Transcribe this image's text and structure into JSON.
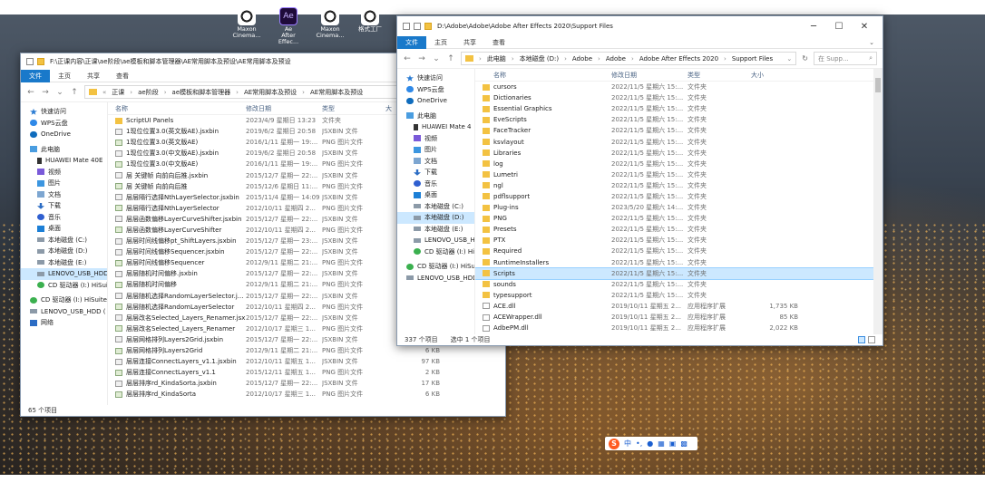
{
  "desktop": {
    "icons": [
      {
        "label": "Maxon\nCinema...",
        "icon": "maxon-icon"
      },
      {
        "label": "Ae\nAfter Effec...",
        "icon": "ae-icon",
        "glyph": "Ae"
      },
      {
        "label": "Maxon\nCinema...",
        "icon": "maxon-icon"
      },
      {
        "label": "格式工厂",
        "icon": "maxon-icon"
      }
    ]
  },
  "left_window": {
    "title": "F:\\正课内容\\正课\\ae阶段\\ae模板和脚本管理器\\AE常用脚本及预设\\AE常用脚本及预设",
    "ribbon": [
      "文件",
      "主页",
      "共享",
      "查看"
    ],
    "breadcrumb": [
      "正课",
      "ae阶段",
      "ae模板和脚本管理器",
      "AE常用脚本及预设",
      "AE常用脚本及预设"
    ],
    "headers": {
      "name": "名称",
      "date": "修改日期",
      "type": "类型",
      "size": "大"
    },
    "nav": [
      {
        "label": "快速访问",
        "icon": "star"
      },
      {
        "label": "WPS云盘",
        "icon": "cloud"
      },
      {
        "label": "OneDrive",
        "icon": "od"
      },
      {
        "label": "此电脑",
        "icon": "pc"
      },
      {
        "label": "HUAWEI Mate 40E",
        "icon": "phone",
        "indent": 1
      },
      {
        "label": "视频",
        "icon": "vid",
        "indent": 1
      },
      {
        "label": "图片",
        "icon": "pic",
        "indent": 1
      },
      {
        "label": "文档",
        "icon": "doc",
        "indent": 1
      },
      {
        "label": "下载",
        "icon": "down",
        "indent": 1
      },
      {
        "label": "音乐",
        "icon": "music",
        "indent": 1
      },
      {
        "label": "桌面",
        "icon": "desk",
        "indent": 1
      },
      {
        "label": "本地磁盘 (C:)",
        "icon": "drive",
        "indent": 1
      },
      {
        "label": "本地磁盘 (D:)",
        "icon": "drive",
        "indent": 1
      },
      {
        "label": "本地磁盘 (E:)",
        "icon": "drive",
        "indent": 1
      },
      {
        "label": "LENOVO_USB_HDD",
        "icon": "drive",
        "indent": 1,
        "selected": true
      },
      {
        "label": "CD 驱动器 (I:) HiSuite",
        "icon": "cd",
        "indent": 1
      },
      {
        "label": "CD 驱动器 (I:) HiSuite",
        "icon": "cd"
      },
      {
        "label": "LENOVO_USB_HDD (",
        "icon": "drive"
      },
      {
        "label": "网络",
        "icon": "net"
      }
    ],
    "files": [
      {
        "name": "ScriptUI Panels",
        "date": "2023/4/9 星期日 13:23",
        "type": "文件夹",
        "size": "",
        "icon": "folder"
      },
      {
        "name": "1现位位置3.0(英文版AE).jsxbin",
        "date": "2019/6/2 星期日 20:58",
        "type": "JSXBIN 文件",
        "size": "",
        "icon": "jsx"
      },
      {
        "name": "1现位位置3.0(英文版AE)",
        "date": "2016/1/11 星期一 19:...",
        "type": "PNG 图片文件",
        "size": "",
        "icon": "png"
      },
      {
        "name": "1现位位置3.0(中文版AE).jsxbin",
        "date": "2019/6/2 星期日 20:58",
        "type": "JSXBIN 文件",
        "size": "",
        "icon": "jsx"
      },
      {
        "name": "1现位位置3.0(中文版AE)",
        "date": "2016/1/11 星期一 19:...",
        "type": "PNG 图片文件",
        "size": "",
        "icon": "png"
      },
      {
        "name": "层 关键帧 向前向后推.jsxbin",
        "date": "2015/12/7 星期一 22:...",
        "type": "JSXBIN 文件",
        "size": "",
        "icon": "jsx"
      },
      {
        "name": "层 关键帧 向前向后推",
        "date": "2015/12/6 星期日 11:...",
        "type": "PNG 图片文件",
        "size": "",
        "icon": "png"
      },
      {
        "name": "层层隔行选择NthLayerSelector.jsxbin",
        "date": "2015/11/4 星期一 14:09",
        "type": "JSXBIN 文件",
        "size": "",
        "icon": "jsx"
      },
      {
        "name": "层层隔行选择NthLayerSelector",
        "date": "2012/10/11 星期四 2...",
        "type": "PNG 图片文件",
        "size": "",
        "icon": "png"
      },
      {
        "name": "层层函数偏移LayerCurveShifter.jsxbin",
        "date": "2015/12/7 星期一 22:...",
        "type": "JSXBIN 文件",
        "size": "",
        "icon": "jsx"
      },
      {
        "name": "层层函数偏移LayerCurveShifter",
        "date": "2012/10/11 星期四 2...",
        "type": "PNG 图片文件",
        "size": "",
        "icon": "png"
      },
      {
        "name": "层层时间线偏移pt_ShiftLayers.jsxbin",
        "date": "2015/12/7 星期一 23:...",
        "type": "JSXBIN 文件",
        "size": "",
        "icon": "jsx"
      },
      {
        "name": "层层时间线偏移Sequencer.jsxbin",
        "date": "2015/12/7 星期一 22:...",
        "type": "JSXBIN 文件",
        "size": "",
        "icon": "jsx"
      },
      {
        "name": "层层时间线偏移Sequencer",
        "date": "2012/9/11 星期二 21:...",
        "type": "PNG 图片文件",
        "size": "",
        "icon": "png"
      },
      {
        "name": "层层随机时间偏移.jsxbin",
        "date": "2015/12/7 星期一 22:...",
        "type": "JSXBIN 文件",
        "size": "",
        "icon": "jsx"
      },
      {
        "name": "层层随机时间偏移",
        "date": "2012/9/11 星期二 21:...",
        "type": "PNG 图片文件",
        "size": "",
        "icon": "png"
      },
      {
        "name": "层层随机选择RandomLayerSelector.j...",
        "date": "2015/12/7 星期一 22:...",
        "type": "JSXBIN 文件",
        "size": "",
        "icon": "jsx"
      },
      {
        "name": "层层随机选择RandomLayerSelector",
        "date": "2012/10/11 星期四 2...",
        "type": "PNG 图片文件",
        "size": "",
        "icon": "png"
      },
      {
        "name": "层层改名Selected_Layers_Renamer.jsxbin",
        "date": "2015/12/7 星期一 22:...",
        "type": "JSXBIN 文件",
        "size": "",
        "icon": "jsx"
      },
      {
        "name": "层层改名Selected_Layers_Renamer",
        "date": "2012/10/17 星期三 1...",
        "type": "PNG 图片文件",
        "size": "2 KB",
        "icon": "png"
      },
      {
        "name": "层层网格排列Layers2Grid.jsxbin",
        "date": "2015/12/7 星期一 22:...",
        "type": "JSXBIN 文件",
        "size": "3 KB",
        "icon": "jsx"
      },
      {
        "name": "层层网格排列Layers2Grid",
        "date": "2012/9/11 星期二 21:...",
        "type": "PNG 图片文件",
        "size": "6 KB",
        "icon": "png"
      },
      {
        "name": "层层连接ConnectLayers_v1.1.jsxbin",
        "date": "2012/10/11 星期五 1...",
        "type": "JSXBIN 文件",
        "size": "97 KB",
        "icon": "jsx"
      },
      {
        "name": "层层连接ConnectLayers_v1.1",
        "date": "2015/12/11 星期五 1...",
        "type": "PNG 图片文件",
        "size": "2 KB",
        "icon": "png"
      },
      {
        "name": "层层排序rd_KindaSorta.jsxbin",
        "date": "2015/12/7 星期一 22:...",
        "type": "JSXBIN 文件",
        "size": "17 KB",
        "icon": "jsx"
      },
      {
        "name": "层层排序rd_KindaSorta",
        "date": "2012/10/17 星期三 1...",
        "type": "PNG 图片文件",
        "size": "6 KB",
        "icon": "png"
      }
    ],
    "status": {
      "count": "65 个项目"
    }
  },
  "right_window": {
    "title": "D:\\Adobe\\Adobe\\Adobe After Effects 2020\\Support Files",
    "ribbon": [
      "文件",
      "主页",
      "共享",
      "查看"
    ],
    "breadcrumb": [
      "此电脑",
      "本地磁盘 (D:)",
      "Adobe",
      "Adobe",
      "Adobe After Effects 2020",
      "Support Files"
    ],
    "search_placeholder": "在 Supp...",
    "headers": {
      "name": "名称",
      "date": "修改日期",
      "type": "类型",
      "size": "大小"
    },
    "nav": [
      {
        "label": "快速访问",
        "icon": "star"
      },
      {
        "label": "WPS云盘",
        "icon": "cloud"
      },
      {
        "label": "OneDrive",
        "icon": "od"
      },
      {
        "label": "此电脑",
        "icon": "pc"
      },
      {
        "label": "HUAWEI Mate 4",
        "icon": "phone",
        "indent": 1
      },
      {
        "label": "视频",
        "icon": "vid",
        "indent": 1
      },
      {
        "label": "图片",
        "icon": "pic",
        "indent": 1
      },
      {
        "label": "文档",
        "icon": "doc",
        "indent": 1
      },
      {
        "label": "下载",
        "icon": "down",
        "indent": 1
      },
      {
        "label": "音乐",
        "icon": "music",
        "indent": 1
      },
      {
        "label": "桌面",
        "icon": "desk",
        "indent": 1
      },
      {
        "label": "本地磁盘 (C:)",
        "icon": "drive",
        "indent": 1
      },
      {
        "label": "本地磁盘 (D:)",
        "icon": "drive",
        "indent": 1,
        "selected": true
      },
      {
        "label": "本地磁盘 (E:)",
        "icon": "drive",
        "indent": 1
      },
      {
        "label": "LENOVO_USB_H",
        "icon": "drive",
        "indent": 1
      },
      {
        "label": "CD 驱动器 (I:) Hi",
        "icon": "cd",
        "indent": 1
      },
      {
        "label": "CD 驱动器 (I:) HiSui",
        "icon": "cd"
      },
      {
        "label": "LENOVO_USB_HDD",
        "icon": "drive"
      }
    ],
    "files": [
      {
        "name": "cursors",
        "date": "2022/11/5 星期六 15:...",
        "type": "文件夹",
        "size": "",
        "icon": "folder"
      },
      {
        "name": "Dictionaries",
        "date": "2022/11/5 星期六 15:...",
        "type": "文件夹",
        "size": "",
        "icon": "folder"
      },
      {
        "name": "Essential Graphics",
        "date": "2022/11/5 星期六 15:...",
        "type": "文件夹",
        "size": "",
        "icon": "folder"
      },
      {
        "name": "EveScripts",
        "date": "2022/11/5 星期六 15:...",
        "type": "文件夹",
        "size": "",
        "icon": "folder"
      },
      {
        "name": "FaceTracker",
        "date": "2022/11/5 星期六 15:...",
        "type": "文件夹",
        "size": "",
        "icon": "folder"
      },
      {
        "name": "ksvlayout",
        "date": "2022/11/5 星期六 15:...",
        "type": "文件夹",
        "size": "",
        "icon": "folder"
      },
      {
        "name": "Libraries",
        "date": "2022/11/5 星期六 15:...",
        "type": "文件夹",
        "size": "",
        "icon": "folder"
      },
      {
        "name": "log",
        "date": "2022/11/5 星期六 15:...",
        "type": "文件夹",
        "size": "",
        "icon": "folder"
      },
      {
        "name": "Lumetri",
        "date": "2022/11/5 星期六 15:...",
        "type": "文件夹",
        "size": "",
        "icon": "folder"
      },
      {
        "name": "ngl",
        "date": "2022/11/5 星期六 15:...",
        "type": "文件夹",
        "size": "",
        "icon": "folder"
      },
      {
        "name": "pdflsupport",
        "date": "2022/11/5 星期六 15:...",
        "type": "文件夹",
        "size": "",
        "icon": "folder"
      },
      {
        "name": "Plug-ins",
        "date": "2023/5/20 星期六 14:...",
        "type": "文件夹",
        "size": "",
        "icon": "folder"
      },
      {
        "name": "PNG",
        "date": "2022/11/5 星期六 15:...",
        "type": "文件夹",
        "size": "",
        "icon": "folder"
      },
      {
        "name": "Presets",
        "date": "2022/11/5 星期六 15:...",
        "type": "文件夹",
        "size": "",
        "icon": "folder"
      },
      {
        "name": "PTX",
        "date": "2022/11/5 星期六 15:...",
        "type": "文件夹",
        "size": "",
        "icon": "folder"
      },
      {
        "name": "Required",
        "date": "2022/11/5 星期六 15:...",
        "type": "文件夹",
        "size": "",
        "icon": "folder"
      },
      {
        "name": "RuntimeInstallers",
        "date": "2022/11/5 星期六 15:...",
        "type": "文件夹",
        "size": "",
        "icon": "folder"
      },
      {
        "name": "Scripts",
        "date": "2022/11/5 星期六 15:...",
        "type": "文件夹",
        "size": "",
        "icon": "folder",
        "selected": true
      },
      {
        "name": "sounds",
        "date": "2022/11/5 星期六 15:...",
        "type": "文件夹",
        "size": "",
        "icon": "folder"
      },
      {
        "name": "typesupport",
        "date": "2022/11/5 星期六 15:...",
        "type": "文件夹",
        "size": "",
        "icon": "folder"
      },
      {
        "name": "ACE.dll",
        "date": "2019/10/11 星期五 2...",
        "type": "应用程序扩展",
        "size": "1,735 KB",
        "icon": "dll"
      },
      {
        "name": "ACEWrapper.dll",
        "date": "2019/10/11 星期五 2...",
        "type": "应用程序扩展",
        "size": "85 KB",
        "icon": "dll"
      },
      {
        "name": "AdbePM.dll",
        "date": "2019/10/11 星期五 2...",
        "type": "应用程序扩展",
        "size": "2,022 KB",
        "icon": "dll"
      }
    ],
    "status": {
      "count": "337 个项目",
      "selected": "选中 1 个项目"
    }
  },
  "ime": {
    "logo": "S",
    "mode": "中"
  },
  "colors": {
    "accent": "#1979ca",
    "selection": "#cce8ff",
    "folder": "#f3c242"
  }
}
